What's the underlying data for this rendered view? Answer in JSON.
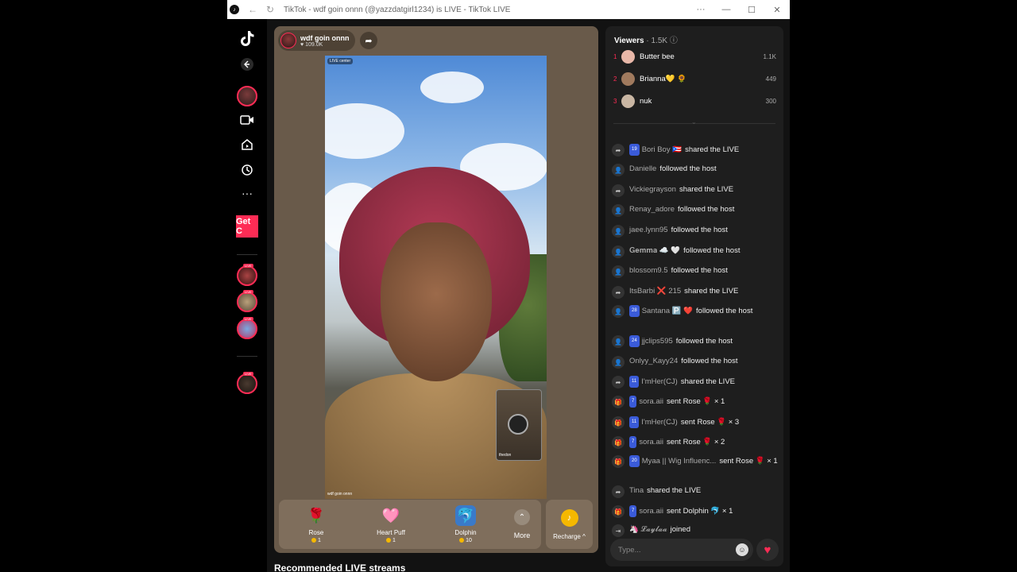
{
  "window": {
    "title": "TikTok - wdf goin onnn (@yazzdatgirl1234) is LIVE - TikTok LIVE",
    "controls": [
      "···",
      "—",
      "☐",
      "✕"
    ]
  },
  "sidebar": {
    "get_coins_label": "Get C",
    "live_tag": "LIVE"
  },
  "stream": {
    "host_name": "wdf goin onnn",
    "host_likes": "109.0K",
    "live_badge": "LIVE center",
    "caption": "wdf goin onnn",
    "guest_name": "thedon"
  },
  "gifts": [
    {
      "name": "Rose",
      "price": "1",
      "icon": "rose-icon",
      "glyph": "🌹"
    },
    {
      "name": "Heart Puff",
      "price": "1",
      "icon": "heart-puff-icon",
      "glyph": "🩷"
    },
    {
      "name": "Dolphin",
      "price": "10",
      "icon": "dolphin-icon",
      "glyph": "🐬"
    }
  ],
  "more_label": "More",
  "recharge_label": "Recharge ^",
  "recommended_title": "Recommended LIVE streams",
  "viewers": {
    "label": "Viewers",
    "count": "· 1.5K",
    "top": [
      {
        "rank": "1",
        "name": "Butter bee",
        "score": "1.1K",
        "color": "#e8b7a8"
      },
      {
        "rank": "2",
        "name": "Brianna💛 🌻",
        "score": "449",
        "color": "#a07a5e"
      },
      {
        "rank": "3",
        "name": "nuk",
        "score": "300",
        "color": "#c9b6a3"
      }
    ]
  },
  "events": [
    {
      "icon": "share-icon",
      "badge": "19",
      "user": "Bori Boy 🇵🇷",
      "action": "shared the LIVE"
    },
    {
      "icon": "follow-icon",
      "badge": "",
      "user": "Danielle",
      "action": "followed the host"
    },
    {
      "icon": "share-icon",
      "badge": "",
      "user": "Vickiegrayson",
      "action": "shared the LIVE"
    },
    {
      "icon": "follow-icon",
      "badge": "",
      "user": "Renay_adore",
      "action": "followed the host"
    },
    {
      "icon": "follow-icon",
      "badge": "",
      "user": "jaee.lynn95",
      "action": "followed the host"
    },
    {
      "icon": "follow-icon",
      "badge": "",
      "user": "𝐆𝐞𝐦𝐦𝐚 ☁️ 🤍",
      "action": "followed the host"
    },
    {
      "icon": "follow-icon",
      "badge": "",
      "user": "blossom9.5",
      "action": "followed the host"
    },
    {
      "icon": "share-icon",
      "badge": "",
      "user": "ItsBarbi ❌ 215",
      "action": "shared the LIVE"
    },
    {
      "icon": "follow-icon",
      "badge": "28",
      "user": "Santana 🅿️ ❤️",
      "action": "followed the host"
    },
    {
      "icon": "follow-icon",
      "badge": "24",
      "user": "jjclips595",
      "action": "followed the host"
    },
    {
      "icon": "follow-icon",
      "badge": "",
      "user": "Onlyy_Kayy24",
      "action": "followed the host"
    },
    {
      "icon": "share-icon",
      "badge": "11",
      "user": "I'mHer(CJ)",
      "action": "shared the LIVE"
    },
    {
      "icon": "gift-icon",
      "badge": "7",
      "user": "sora.aii",
      "action": "sent Rose 🌹 × 1"
    },
    {
      "icon": "gift-icon",
      "badge": "11",
      "user": "I'mHer(CJ)",
      "action": "sent Rose 🌹 × 3"
    },
    {
      "icon": "gift-icon",
      "badge": "7",
      "user": "sora.aii",
      "action": "sent Rose 🌹 × 2"
    },
    {
      "icon": "gift-icon",
      "badge": "20",
      "user": "Myaa || Wig Influenc...",
      "action": "sent Rose 🌹 × 1"
    },
    {
      "icon": "share-icon",
      "badge": "",
      "user": "Tina",
      "action": "shared the LIVE"
    },
    {
      "icon": "gift-icon",
      "badge": "7",
      "user": "sora.aii",
      "action": "sent Dolphin 🐬 × 1"
    },
    {
      "icon": "join-icon",
      "badge": "",
      "user": "🦄 𝓛𝓪𝔂𝓵𝓪𝓪",
      "action": "joined"
    }
  ],
  "chat": {
    "placeholder": "Type..."
  }
}
